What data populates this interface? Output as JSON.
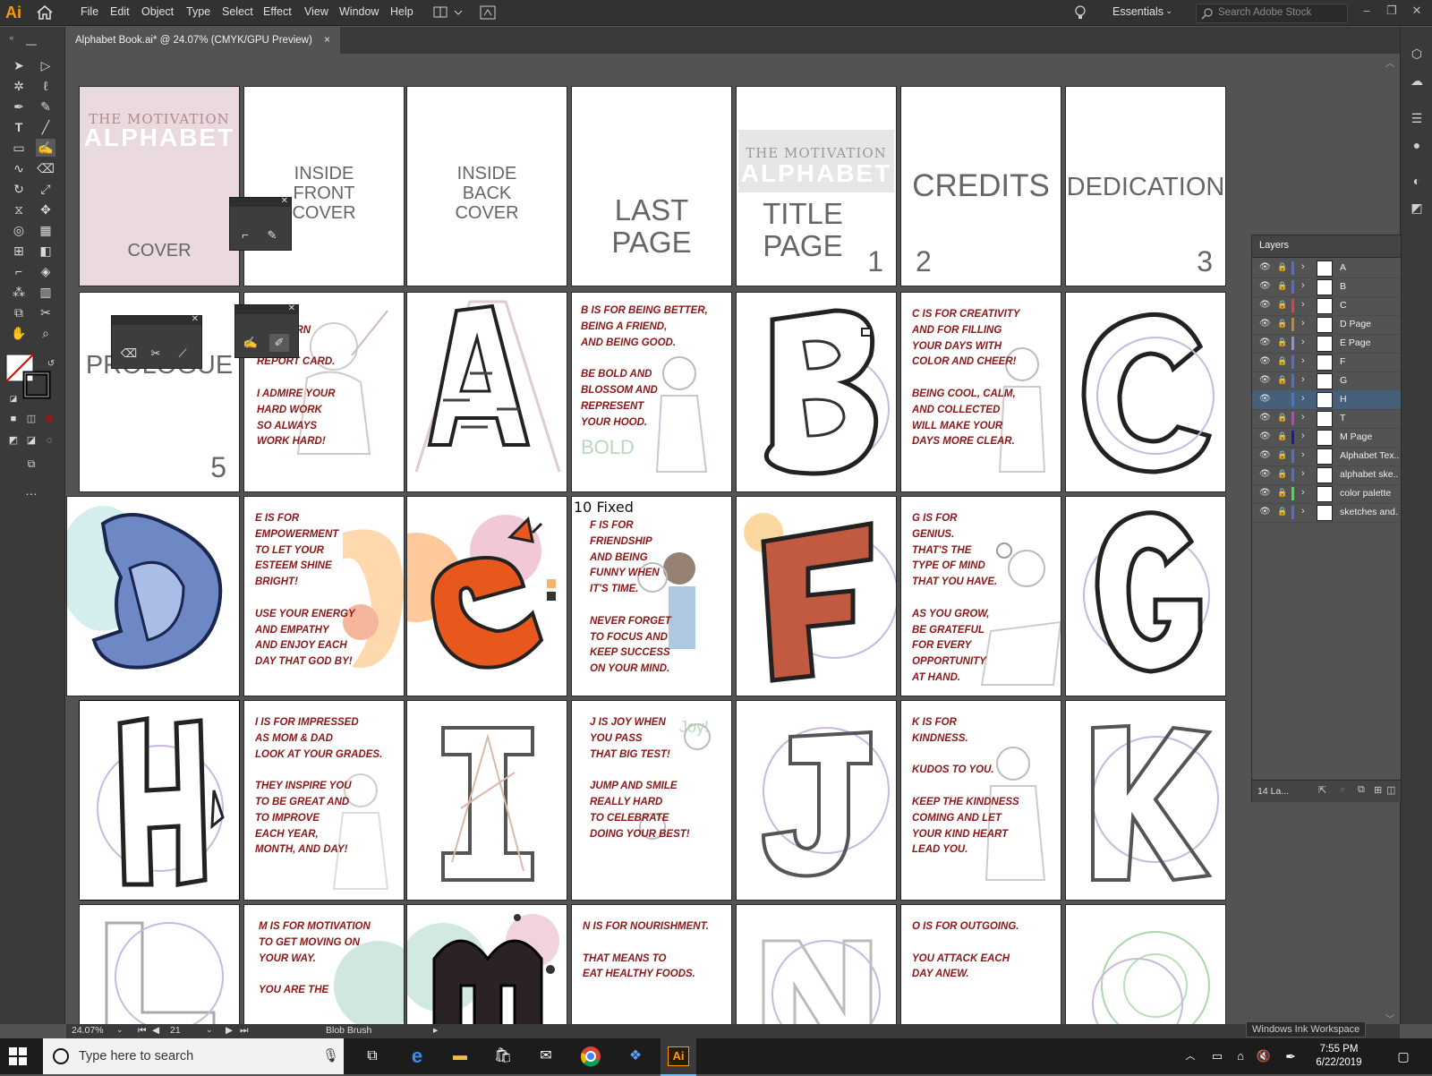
{
  "app": {
    "logo": "Ai"
  },
  "menu": [
    "File",
    "Edit",
    "Object",
    "Type",
    "Select",
    "Effect",
    "View",
    "Window",
    "Help"
  ],
  "workspace": "Essentials",
  "stock_search": {
    "placeholder": "Search Adobe Stock"
  },
  "document_tab": {
    "title": "Alphabet Book.ai* @ 24.07% (CMYK/GPU Preview)",
    "close": "×"
  },
  "layers_panel": {
    "title": "Layers",
    "layers": [
      {
        "name": "A",
        "color": "#4f6fd8",
        "locked": true
      },
      {
        "name": "B",
        "color": "#4f6fd8",
        "locked": true
      },
      {
        "name": "C",
        "color": "#e04040",
        "locked": true
      },
      {
        "name": "D Page",
        "color": "#c7862e",
        "locked": true
      },
      {
        "name": "E Page",
        "color": "#8f8fe0",
        "locked": true
      },
      {
        "name": "F",
        "color": "#4f6fd8",
        "locked": true
      },
      {
        "name": "G",
        "color": "#4f6fd8",
        "locked": true
      },
      {
        "name": "H",
        "color": "#4f6fd8",
        "locked": false,
        "selected": true
      },
      {
        "name": "T",
        "color": "#c040c0",
        "locked": true
      },
      {
        "name": "M Page",
        "color": "#1a1aa0",
        "locked": true
      },
      {
        "name": "Alphabet Tex...",
        "color": "#4f6fd8",
        "locked": true
      },
      {
        "name": "alphabet ske...",
        "color": "#4f6fd8",
        "locked": true
      },
      {
        "name": "color palette",
        "color": "#40e040",
        "locked": true
      },
      {
        "name": "sketches and...",
        "color": "#4f6fd8",
        "locked": true
      }
    ],
    "count": "14 La..."
  },
  "artboards": {
    "cover": {
      "title1": "THE MOTIVATION",
      "title2": "ALPHABET",
      "label": "COVER"
    },
    "inside_front": "INSIDE\nFRONT\nCOVER",
    "inside_back": "INSIDE\nBACK\nCOVER",
    "last_page": "LAST\nPAGE",
    "title_page": {
      "title1": "THE MOTIVATION",
      "title2": "ALPHABET",
      "label": "TITLE\nPAGE",
      "num": "1"
    },
    "credits": {
      "label": "CREDITS",
      "num": "2"
    },
    "dedication": {
      "label": "DEDICATION",
      "num": "3"
    },
    "prologue": {
      "label": "PROLOGUE",
      "num": "5"
    },
    "a_text": "ALL A'S\n     U EARN\n\nREPORT CARD.\n\nI ADMIRE YOUR\nHARD WORK\nSO ALWAYS\nWORK HARD!",
    "b_text": "B IS FOR BEING BETTER,\nBEING A FRIEND,\nAND BEING GOOD.\n\nBE BOLD AND\nBLOSSOM AND\nREPRESENT\nYOUR HOOD.",
    "c_text": "C IS FOR CREATIVITY\nAND FOR FILLING\nYOUR DAYS WITH\nCOLOR AND CHEER!\n\nBEING COOL, CALM,\nAND COLLECTED\nWILL MAKE YOUR\nDAYS MORE CLEAR.",
    "e_text": "E IS FOR\nEMPOWERMENT\nTO LET YOUR\nESTEEM SHINE\nBRIGHT!\n\nUSE YOUR ENERGY\nAND EMPATHY\nAND ENJOY EACH\nDAY THAT GOD BY!",
    "f_note": "10 Fixed",
    "f_text": "F IS FOR\nFRIENDSHIP\nAND BEING\nFUNNY WHEN\nIT'S TIME.\n\nNEVER FORGET\nTO FOCUS AND\nKEEP SUCCESS\nON YOUR MIND.",
    "g_text": "G IS FOR\nGENIUS.\nTHAT'S THE\nTYPE OF MIND\nTHAT YOU HAVE.\n\nAS YOU GROW,\nBE GRATEFUL\nFOR EVERY\nOPPORTUNITY\nAT HAND.",
    "i_text": "I IS FOR IMPRESSED\nAS MOM & DAD\nLOOK AT YOUR GRADES.\n\nTHEY INSPIRE YOU\nTO BE GREAT AND\nTO IMPROVE\nEACH YEAR,\nMONTH, AND DAY!",
    "j_text": "J IS JOY WHEN\nYOU PASS\nTHAT BIG TEST!\n\nJUMP AND SMILE\nREALLY HARD\nTO CELEBRATE\nDOING YOUR BEST!",
    "k_text": "K IS FOR\nKINDNESS.\n\nKUDOS TO YOU.\n\nKEEP THE KINDNESS\nCOMING AND LET\nYOUR KIND HEART\nLEAD YOU.",
    "m_text": "M IS FOR MOTIVATION\nTO GET MOVING ON\nYOUR WAY.\n\nYOU ARE THE",
    "n_text": "N IS FOR NOURISHMENT.\n\nTHAT MEANS TO\nEAT HEALTHY FOODS.",
    "o_text": "O IS FOR OUTGOING.\n\nYOU ATTACK EACH\nDAY ANEW."
  },
  "statusbar": {
    "zoom": "24.07%",
    "artboard": "21",
    "tool": "Blob Brush"
  },
  "taskbar": {
    "search_placeholder": "Type here to search",
    "time": "7:55 PM",
    "date": "6/22/2019"
  },
  "tooltip": "Windows Ink Workspace"
}
